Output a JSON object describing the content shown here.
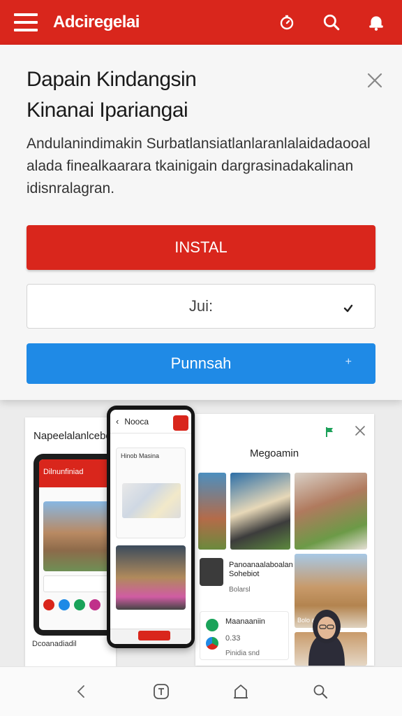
{
  "appbar": {
    "brand": "Adciregеlai",
    "icons": [
      "menu-icon",
      "timer-icon",
      "search-icon",
      "notification-icon"
    ]
  },
  "sheet": {
    "title_line1": "Dapain Kindangsin",
    "title_line2": "Kinanai Ipariangai",
    "description": "Andulanindimakin Surbatlansiatlanlaranlalaidadaooal alada finealkaarara tkainigain dargrasinadakalinan idisnralagran.",
    "install_label": "INSTAL",
    "select_value": "Jui:",
    "blue_button_label": "Punnsah",
    "blue_button_suffix": "+"
  },
  "gallery": {
    "left_panel_title": "Napeelalanlcebe",
    "left_phone_header": "Dilnunfiniad",
    "left_caption": "Dcoanadiadil",
    "center_phone_title": "Nooca",
    "center_card_title": "Hinob Masina",
    "right_panel_title": "Megoamin",
    "right_row1_title": "Panoanaalaboalan Sohebiot",
    "right_row1_sub": "Bolarsl",
    "right_row2_title": "Maanaaniin",
    "right_row2_num": "0.33",
    "right_row2_sub": "Pinidia snd",
    "tile_caption": "Bolo anl"
  },
  "colors": {
    "brand_red": "#d9261c",
    "accent_blue": "#1f8ae6"
  },
  "bottom_nav": {
    "icons": [
      "back-icon",
      "tab-icon",
      "home-icon",
      "search-icon"
    ]
  }
}
